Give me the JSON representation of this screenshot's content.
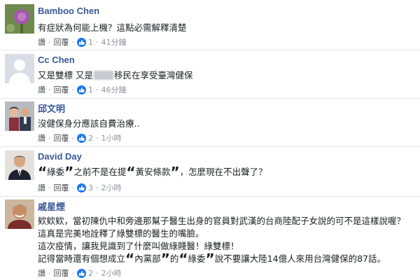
{
  "comments": [
    {
      "name": "Bamboo Chen",
      "lines": [
        "有症狀為何能上機？這點必需解釋清楚"
      ],
      "like_label": "讚",
      "reply_label": "回覆",
      "likes": "1",
      "time": "41分鐘"
    },
    {
      "name": "Cc Chen",
      "text_before": "又是雙標 又是",
      "text_after": "移民在享受臺灣健保",
      "like_label": "讚",
      "reply_label": "回覆",
      "likes": "1",
      "time": "46分鐘"
    },
    {
      "name": "邱文明",
      "lines": [
        "沒健保身分應該自費治療.."
      ],
      "like_label": "讚",
      "reply_label": "回覆",
      "likes": "2",
      "time": "1小時"
    },
    {
      "name": "David Day",
      "segments": [
        "綠委",
        "之前不是在提",
        "黃安條款",
        "，怎麼現在不出聲了？"
      ],
      "like_label": "讚",
      "reply_label": "回覆",
      "likes": "3",
      "time": "2小時"
    },
    {
      "name": "戚星煙",
      "lines": [
        "欸欸欸，當初陳仇中和旁邊那幫子醫生出身的官員對武漢的台商陸配子女說的可不是這樣說喔？",
        "這真是完美地詮釋了綠雙標的醫生的嘴臉。",
        "這次疫情，讓我見識到了什麼叫做綠賤醫！綠雙標！"
      ],
      "last_segments": [
        "記得當時還有個想成立",
        "內黨部",
        "的",
        "綠委",
        "說不要讓大陸14億人來用台灣健保的87話。"
      ],
      "like_label": "讚",
      "reply_label": "回覆",
      "likes": "2",
      "time": "2小時"
    }
  ],
  "icons": {
    "like": "thumbs-up-icon"
  },
  "colors": {
    "name": "#385898",
    "like_badge": "#1877f2"
  }
}
